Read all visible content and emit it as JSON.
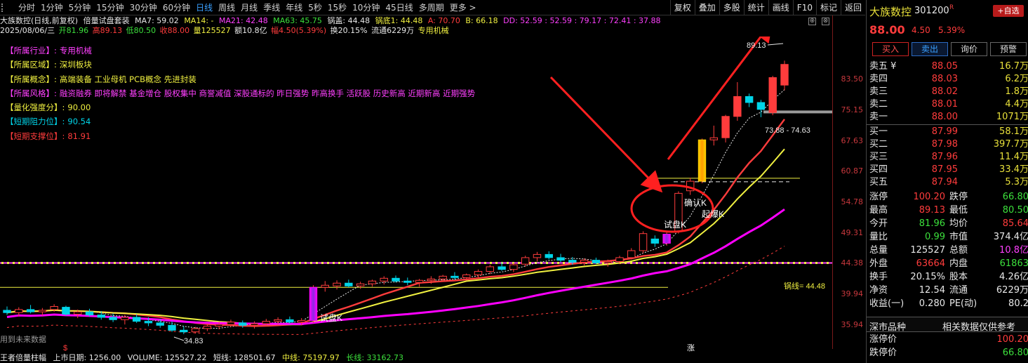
{
  "toolbar": {
    "periods": [
      "分时",
      "1分钟",
      "5分钟",
      "15分钟",
      "30分钟",
      "60分钟",
      "日线",
      "周线",
      "月线",
      "季线",
      "年线",
      "5秒",
      "15秒",
      "10分钟",
      "45日线",
      "多周期",
      "更多 >"
    ],
    "active_period": "日线",
    "tools": [
      "复权",
      "叠加",
      "多股",
      "统计",
      "画线",
      "F10",
      "标记",
      "返回"
    ]
  },
  "info": {
    "title": "大族数控(日线,前复权)",
    "indicator": "倍量试盘套装",
    "ma7": "MA7: 59.02",
    "ma14": "MA14: -",
    "ma21": "MA21: 42.48",
    "ma63": "MA63: 45.75",
    "guogai": "锅盖: 44.48",
    "guodi": "锅底1: 44.48",
    "a": "A: 70.70",
    "b": "B: 66.18",
    "dd": "DD: 52.59 : 52.59 : 79.17 : 72.41 : 37.88",
    "date": "2025/08/06/三",
    "open": "开81.96",
    "high": "高89.13",
    "low": "低80.50",
    "close": "收88.00",
    "volume": "量125527",
    "amount": "额10.8亿",
    "range": "幅4.50(5.39%)",
    "turnover": "换20.15%",
    "float": "流通6229万",
    "industry": "专用机械",
    "controls": [
      "⊕",
      "⊗"
    ]
  },
  "fundamentals": {
    "industry_k": "【所属行业】:",
    "industry_v": "专用机械",
    "region_k": "【所属区域】:",
    "region_v": "深圳板块",
    "concept_k": "【所属概念】:",
    "concept_v": "高端装备 工业母机 PCB概念 先进封装",
    "style_k": "【所属风格】:",
    "style_v": "融资融券 即将解禁 基金增仓 股权集中 商誉减值 深股通标的 昨日强势 昨高换手 活跃股 历史新高 近期新高 近期强势",
    "quant_k": "【量化强度分】:",
    "quant_v": "90.00",
    "resist_k": "【短期阻力位】:",
    "resist_v": "90.54",
    "support_k": "【短期支撑位】:",
    "support_v": "81.91"
  },
  "chart_labels": {
    "peak": "89.13",
    "range": "73.88 - 74.63",
    "trial": "试盘K",
    "trial2": "试盘K",
    "confirm": "确认K",
    "start": "起爆K",
    "low": "34.83",
    "guogai": "锅线= 44.48",
    "future": "用到未来数据",
    "zhang": "涨",
    "s_mark": "$"
  },
  "colors": {
    "up": "#ff3c3c",
    "down": "#00d4e8",
    "magenta": "#ff00ff",
    "yellow": "#f0f040",
    "axis": "#c8383d"
  },
  "yaxis": {
    "ticks": [
      "83.50",
      "75.15",
      "67.63",
      "60.87",
      "54.78",
      "49.31",
      "44.38",
      "39.94",
      "35.94"
    ]
  },
  "chart_data": {
    "type": "candlestick",
    "scale": "log",
    "candles": [
      {
        "o": 37.8,
        "h": 38.3,
        "l": 37.2,
        "c": 37.5
      },
      {
        "o": 37.5,
        "h": 38.2,
        "l": 37.0,
        "c": 37.9
      },
      {
        "o": 37.9,
        "h": 38.5,
        "l": 37.4,
        "c": 37.6
      },
      {
        "o": 37.6,
        "h": 38.1,
        "l": 37.1,
        "c": 37.8
      },
      {
        "o": 37.9,
        "h": 38.6,
        "l": 37.6,
        "c": 38.3
      },
      {
        "o": 38.2,
        "h": 38.4,
        "l": 37.1,
        "c": 37.3
      },
      {
        "o": 37.3,
        "h": 37.9,
        "l": 36.8,
        "c": 37.6
      },
      {
        "o": 37.6,
        "h": 38.0,
        "l": 37.0,
        "c": 37.2
      },
      {
        "o": 37.2,
        "h": 37.7,
        "l": 36.6,
        "c": 36.9
      },
      {
        "o": 36.9,
        "h": 37.4,
        "l": 36.3,
        "c": 36.6
      },
      {
        "o": 36.6,
        "h": 37.2,
        "l": 36.0,
        "c": 36.9
      },
      {
        "o": 36.9,
        "h": 37.3,
        "l": 36.2,
        "c": 36.4
      },
      {
        "o": 36.4,
        "h": 36.9,
        "l": 35.8,
        "c": 36.2
      },
      {
        "o": 36.2,
        "h": 36.7,
        "l": 35.6,
        "c": 35.9
      },
      {
        "o": 35.9,
        "h": 36.4,
        "l": 35.1,
        "c": 35.3
      },
      {
        "o": 35.3,
        "h": 35.8,
        "l": 34.83,
        "c": 35.1
      },
      {
        "o": 35.1,
        "h": 35.7,
        "l": 34.9,
        "c": 35.5
      },
      {
        "o": 35.5,
        "h": 36.1,
        "l": 35.2,
        "c": 35.8
      },
      {
        "o": 35.8,
        "h": 36.3,
        "l": 35.4,
        "c": 36.0
      },
      {
        "o": 36.0,
        "h": 36.6,
        "l": 35.7,
        "c": 36.3
      },
      {
        "o": 36.2,
        "h": 36.5,
        "l": 35.6,
        "c": 35.9
      },
      {
        "o": 35.9,
        "h": 36.4,
        "l": 35.5,
        "c": 36.1
      },
      {
        "o": 36.1,
        "h": 36.7,
        "l": 35.8,
        "c": 36.4
      },
      {
        "o": 36.4,
        "h": 36.9,
        "l": 36.0,
        "c": 36.6
      },
      {
        "o": 36.6,
        "h": 37.0,
        "l": 36.1,
        "c": 36.3
      },
      {
        "o": 36.3,
        "h": 36.8,
        "l": 35.9,
        "c": 36.5
      },
      {
        "o": 36.5,
        "h": 41.2,
        "l": 36.2,
        "c": 40.9
      },
      {
        "o": 40.9,
        "h": 41.8,
        "l": 40.3,
        "c": 41.2
      },
      {
        "o": 41.1,
        "h": 41.9,
        "l": 40.6,
        "c": 41.5
      },
      {
        "o": 41.5,
        "h": 42.0,
        "l": 40.9,
        "c": 41.1
      },
      {
        "o": 41.1,
        "h": 41.7,
        "l": 40.7,
        "c": 41.4
      },
      {
        "o": 41.4,
        "h": 42.0,
        "l": 41.0,
        "c": 41.8
      },
      {
        "o": 41.8,
        "h": 42.5,
        "l": 41.3,
        "c": 42.2
      },
      {
        "o": 42.2,
        "h": 42.6,
        "l": 41.6,
        "c": 41.8
      },
      {
        "o": 41.8,
        "h": 42.3,
        "l": 41.2,
        "c": 41.6
      },
      {
        "o": 41.6,
        "h": 42.1,
        "l": 41.0,
        "c": 41.9
      },
      {
        "o": 41.9,
        "h": 42.5,
        "l": 41.4,
        "c": 42.1
      },
      {
        "o": 42.1,
        "h": 42.7,
        "l": 41.7,
        "c": 42.5
      },
      {
        "o": 42.5,
        "h": 43.1,
        "l": 42.0,
        "c": 42.3
      },
      {
        "o": 42.3,
        "h": 42.9,
        "l": 41.9,
        "c": 42.7
      },
      {
        "o": 42.7,
        "h": 43.5,
        "l": 42.3,
        "c": 43.2
      },
      {
        "o": 43.2,
        "h": 44.2,
        "l": 42.8,
        "c": 43.9
      },
      {
        "o": 43.9,
        "h": 44.6,
        "l": 43.3,
        "c": 43.5
      },
      {
        "o": 43.5,
        "h": 44.5,
        "l": 43.1,
        "c": 44.2
      },
      {
        "o": 44.3,
        "h": 45.6,
        "l": 43.9,
        "c": 45.3
      },
      {
        "o": 45.3,
        "h": 46.2,
        "l": 44.7,
        "c": 45.8
      },
      {
        "o": 45.8,
        "h": 46.3,
        "l": 45.0,
        "c": 45.3
      },
      {
        "o": 45.3,
        "h": 45.9,
        "l": 44.6,
        "c": 44.9
      },
      {
        "o": 44.9,
        "h": 45.4,
        "l": 44.2,
        "c": 44.6
      },
      {
        "o": 44.6,
        "h": 45.2,
        "l": 44.1,
        "c": 44.9
      },
      {
        "o": 44.9,
        "h": 45.3,
        "l": 44.3,
        "c": 44.5
      },
      {
        "o": 44.5,
        "h": 45.0,
        "l": 43.9,
        "c": 44.7
      },
      {
        "o": 44.7,
        "h": 45.6,
        "l": 44.3,
        "c": 45.3
      },
      {
        "o": 45.3,
        "h": 46.8,
        "l": 45.0,
        "c": 46.4
      },
      {
        "o": 46.4,
        "h": 49.6,
        "l": 46.0,
        "c": 49.2
      },
      {
        "o": 48.3,
        "h": 48.9,
        "l": 47.0,
        "c": 47.6
      },
      {
        "o": 47.6,
        "h": 49.5,
        "l": 47.2,
        "c": 49.1
      },
      {
        "o": 49.6,
        "h": 56.9,
        "l": 49.2,
        "c": 56.5
      },
      {
        "o": 57.0,
        "h": 59.6,
        "l": 56.2,
        "c": 58.9
      },
      {
        "o": 58.9,
        "h": 68.2,
        "l": 58.5,
        "c": 67.9
      },
      {
        "o": 67.9,
        "h": 71.3,
        "l": 66.6,
        "c": 68.4
      },
      {
        "o": 68.4,
        "h": 74.0,
        "l": 67.3,
        "c": 73.6
      },
      {
        "o": 73.6,
        "h": 82.8,
        "l": 72.5,
        "c": 78.8
      },
      {
        "o": 78.8,
        "h": 79.6,
        "l": 76.0,
        "c": 77.2
      },
      {
        "o": 77.2,
        "h": 77.9,
        "l": 73.4,
        "c": 75.4
      },
      {
        "o": 74.6,
        "h": 84.6,
        "l": 73.9,
        "c": 84.1
      },
      {
        "o": 81.96,
        "h": 89.13,
        "l": 80.5,
        "c": 88.0
      }
    ]
  },
  "statusbar": {
    "text1": "王者倍量柱幅",
    "text2": "上市日期: 1256.00",
    "vol": "VOLUME: 125527.22",
    "short": "短线: 128501.67",
    "mid": "中线: 75197.97",
    "long": "长线: 33162.73"
  },
  "quote": {
    "name": "大族数控",
    "code": "301200",
    "badge": "R",
    "add_fav": "+自选",
    "price": "88.00",
    "change": "4.50",
    "change_pct": "5.39%",
    "actions": [
      "买入",
      "卖出",
      "询价",
      "预警"
    ],
    "asks": [
      {
        "label": "卖五 ¥",
        "price": "88.05",
        "vol": "16.7万"
      },
      {
        "label": "卖四",
        "price": "88.03",
        "vol": "6.2万"
      },
      {
        "label": "卖三",
        "price": "88.02",
        "vol": "1.8万"
      },
      {
        "label": "卖二",
        "price": "88.01",
        "vol": "4.4万"
      },
      {
        "label": "卖一",
        "price": "88.00",
        "vol": "1071万"
      }
    ],
    "bids": [
      {
        "label": "买一",
        "price": "87.99",
        "vol": "58.1万"
      },
      {
        "label": "买二",
        "price": "87.98",
        "vol": "397.7万"
      },
      {
        "label": "买三",
        "price": "87.96",
        "vol": "11.4万"
      },
      {
        "label": "买四",
        "price": "87.95",
        "vol": "33.4万"
      },
      {
        "label": "买五",
        "price": "87.94",
        "vol": "5.3万"
      }
    ],
    "stats": [
      {
        "l1": "涨停",
        "v1": "100.20",
        "c1": "#ff3c3c",
        "l2": "跌停",
        "v2": "66.80",
        "c2": "#3ce03c"
      },
      {
        "l1": "最高",
        "v1": "89.13",
        "c1": "#ff3c3c",
        "l2": "最低",
        "v2": "80.50",
        "c2": "#3ce03c"
      },
      {
        "l1": "今开",
        "v1": "81.96",
        "c1": "#3ce03c",
        "l2": "均价",
        "v2": "85.64",
        "c2": "#ff3c3c"
      },
      {
        "l1": "量比",
        "v1": "0.99",
        "c1": "#3ce03c",
        "l2": "市值",
        "v2": "374.4亿",
        "c2": "#e8e8e8"
      },
      {
        "l1": "总量",
        "v1": "125527",
        "c1": "#e8e8e8",
        "l2": "总额",
        "v2": "10.8亿",
        "c2": "#ff40ff"
      },
      {
        "l1": "外盘",
        "v1": "63664",
        "c1": "#ff3c3c",
        "l2": "内盘",
        "v2": "61863",
        "c2": "#3ce03c"
      },
      {
        "l1": "换手",
        "v1": "20.15%",
        "c1": "#e8e8e8",
        "l2": "股本",
        "v2": "4.26亿",
        "c2": "#e8e8e8"
      },
      {
        "l1": "净资",
        "v1": "12.54",
        "c1": "#e8e8e8",
        "l2": "流通",
        "v2": "6229万",
        "c2": "#e8e8e8"
      },
      {
        "l1": "收益(一)",
        "v1": "0.280",
        "c1": "#e8e8e8",
        "l2": "PE(动)",
        "v2": "80.2",
        "c2": "#e8e8e8"
      }
    ],
    "market": "深市品种",
    "market_note": "相关数据仅供参考",
    "limit_up_k": "涨停价",
    "limit_up_v": "100.20",
    "limit_down_k": "跌停价",
    "limit_down_v": "66.80"
  }
}
